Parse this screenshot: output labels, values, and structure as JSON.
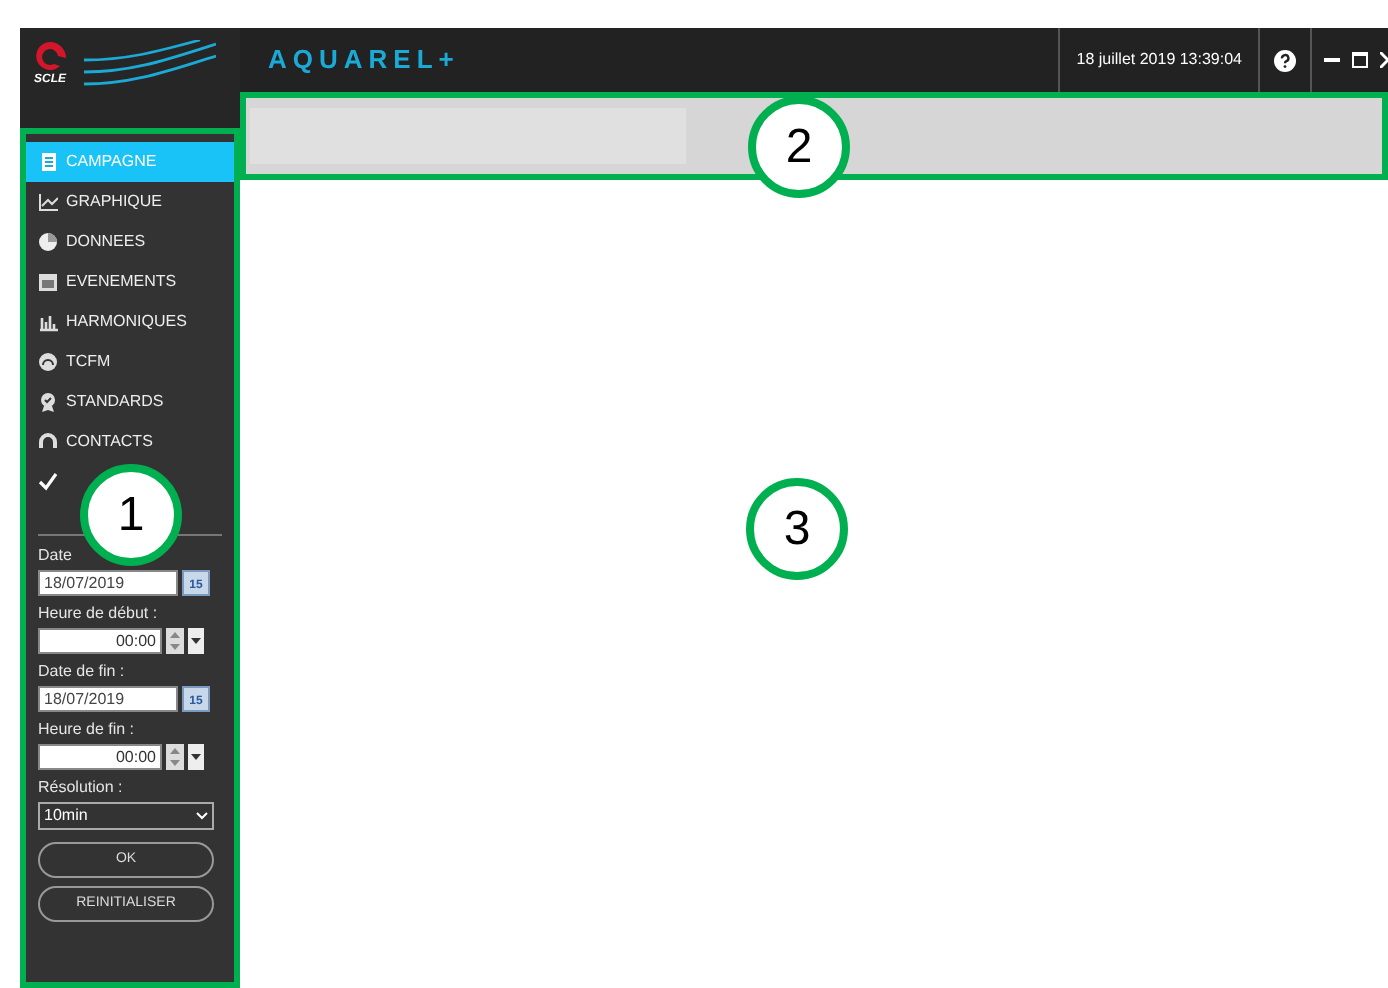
{
  "header": {
    "logo_text": "SCLE",
    "app_title": "AQUAREL+",
    "datetime": "18 juillet 2019 13:39:04"
  },
  "nav": [
    {
      "kind": "document",
      "label": "CAMPAGNE",
      "selected": true
    },
    {
      "kind": "chart",
      "label": "GRAPHIQUE",
      "selected": false
    },
    {
      "kind": "pie",
      "label": "DONNEES",
      "selected": false
    },
    {
      "kind": "calendar",
      "label": "EVENEMENTS",
      "selected": false
    },
    {
      "kind": "bars",
      "label": "HARMONIQUES",
      "selected": false
    },
    {
      "kind": "gauge",
      "label": "TCFM",
      "selected": false
    },
    {
      "kind": "badge",
      "label": "STANDARDS",
      "selected": false
    },
    {
      "kind": "headset",
      "label": "CONTACTS",
      "selected": false
    },
    {
      "kind": "check",
      "selected": false
    }
  ],
  "form": [
    {
      "kind": "date",
      "label": "Date",
      "value": "18/07/2019",
      "day": "15"
    },
    {
      "kind": "time",
      "label": "Heure de début :",
      "value": "00:00"
    },
    {
      "kind": "date",
      "label": "Date de fin :",
      "value": "18/07/2019",
      "day": "15"
    },
    {
      "kind": "time",
      "label": "Heure de fin :",
      "value": "00:00"
    },
    {
      "kind": "select",
      "label": "Résolution :",
      "value": "10min"
    }
  ],
  "buttons": [
    "OK",
    "REINITIALISER"
  ],
  "callouts": [
    "1",
    "2",
    "3"
  ]
}
